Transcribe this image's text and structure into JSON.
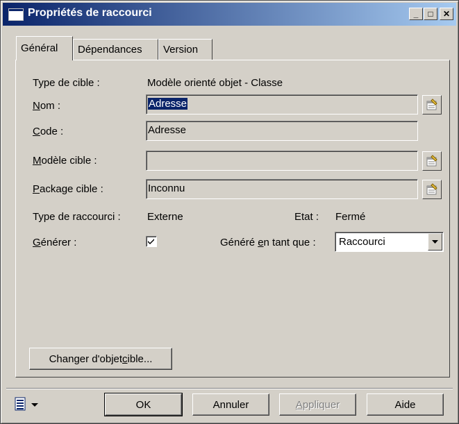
{
  "window": {
    "title": "Propriétés de raccourci"
  },
  "titlebar_buttons": {
    "minimize": "_",
    "maximize": "□",
    "close": "✕"
  },
  "tabs": [
    {
      "label": "Général"
    },
    {
      "label": "Dépendances"
    },
    {
      "label": "Version"
    }
  ],
  "general": {
    "target_type": {
      "label": "Type de cible :",
      "value": "Modèle orienté objet - Classe"
    },
    "name": {
      "label_u": "N",
      "label_rest": "om :",
      "value": "Adresse"
    },
    "code": {
      "label_u": "C",
      "label_rest": "ode :",
      "value": "Adresse"
    },
    "target_model": {
      "label_u": "M",
      "label_rest": "odèle cible :",
      "value": ""
    },
    "target_package": {
      "label_u": "P",
      "label_rest": "ackage cible :",
      "value": "Inconnu"
    },
    "shortcut_type": {
      "label": "Type de raccourci :",
      "value": "Externe"
    },
    "state": {
      "label": "Etat :",
      "value": "Fermé"
    },
    "generate": {
      "label_u": "G",
      "label_rest": "énérer :",
      "checked": true
    },
    "generated_as": {
      "label_pre": "Généré ",
      "label_u": "e",
      "label_rest": "n tant que :",
      "value": "Raccourci"
    },
    "change_target": {
      "pre": "Changer d'objet ",
      "u": "c",
      "rest": "ible..."
    }
  },
  "footer": {
    "ok": "OK",
    "cancel": "Annuler",
    "apply_u": "A",
    "apply_rest": "ppliquer",
    "help": "Aide"
  },
  "colors": {
    "title_start": "#0a246a",
    "title_end": "#a6caf0",
    "face": "#d4d0c8",
    "selection": "#0a246a"
  }
}
